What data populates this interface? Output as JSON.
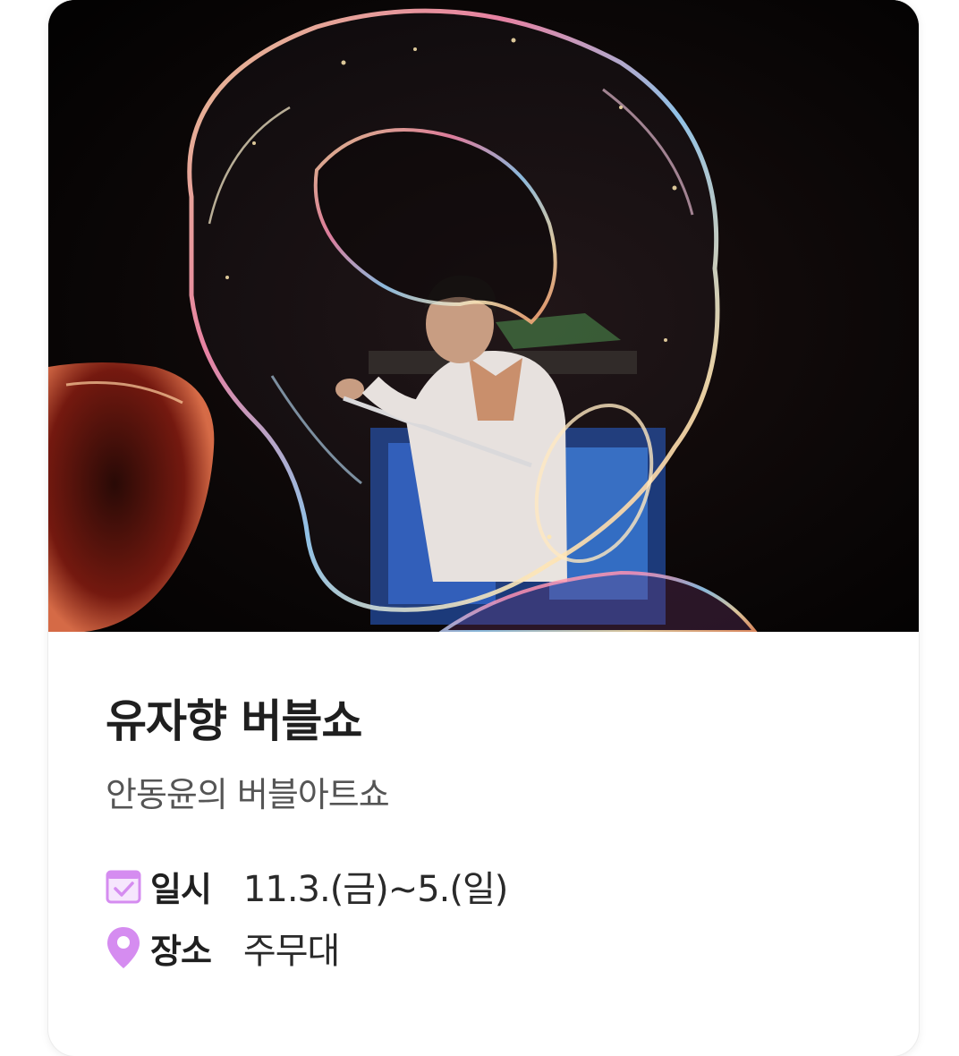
{
  "event": {
    "image_alt": "버블쇼 공연 사진",
    "title": "유자향 버블쇼",
    "subtitle": "안동윤의 버블아트쇼",
    "date": {
      "icon": "calendar-check-icon",
      "label": "일시",
      "value": "11.3.(금)~5.(일)"
    },
    "place": {
      "icon": "location-pin-icon",
      "label": "장소",
      "value": "주무대"
    }
  },
  "colors": {
    "icon_accent": "#d58cf0",
    "title": "#1f1f1f",
    "subtitle": "#555555",
    "photo_background": "#050303"
  }
}
